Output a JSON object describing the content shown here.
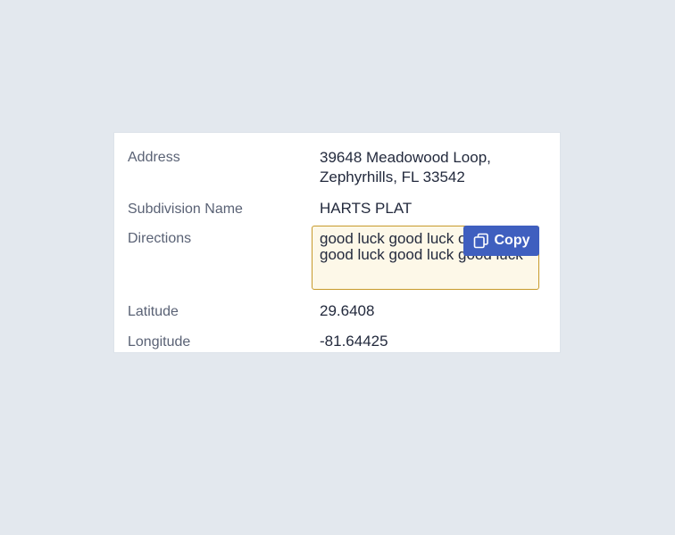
{
  "details": {
    "address_label": "Address",
    "address_line1": "39648 Meadowood Loop,",
    "address_line2": "Zephyrhills, FL 33542",
    "subdivision_label": "Subdivision Name",
    "subdivision_value": "HARTS PLAT",
    "directions_label": "Directions",
    "directions_value": "good luck good luck oh oh good luck good luck good luck",
    "latitude_label": "Latitude",
    "latitude_value": "29.6408",
    "longitude_label": "Longitude",
    "longitude_value": "-81.64425"
  },
  "copy_button": {
    "label": "Copy",
    "icon": "copy-icon",
    "color": "#3f5fbf"
  },
  "colors": {
    "background": "#e3e8ee",
    "card": "#ffffff",
    "highlight_fill": "#fdf8e8",
    "highlight_border": "#c79a2a"
  }
}
